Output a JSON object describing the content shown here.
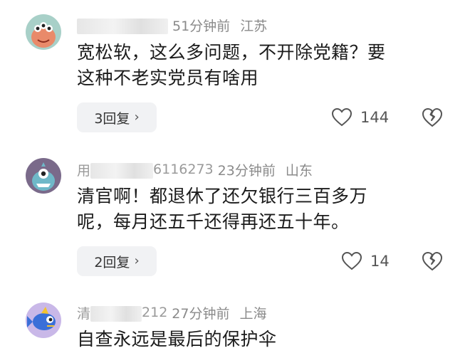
{
  "comments": [
    {
      "username_visible": "",
      "time": "51分钟前",
      "location": "江苏",
      "text_lines": [
        "宽松软，这么多问题，不开除党籍？要",
        "这种不老实党员有啥用"
      ],
      "reply_label": "3回复",
      "likes": "144",
      "avatar_icon": "monster-avatar-icon",
      "avatar_color": "#a8d0c8"
    },
    {
      "username_visible": "用",
      "username_tail": "6116273",
      "time": "23分钟前",
      "location": "山东",
      "text_lines": [
        "清官啊！都退休了还欠银行三百多万",
        "呢，每月还五千还得再还五十年。"
      ],
      "reply_label": "2回复",
      "likes": "14",
      "avatar_icon": "monster-avatar-icon",
      "avatar_color": "#7a6a8a"
    },
    {
      "username_visible": "清",
      "username_tail": "212",
      "time": "27分钟前",
      "location": "上海",
      "text_lines": [
        "自查永远是最后的保护伞"
      ],
      "avatar_icon": "fish-avatar-icon",
      "avatar_color": "#c9b8e8"
    }
  ],
  "colors": {
    "reply_bg": "#f1f2f4",
    "meta_text": "#8a8a8a",
    "body_text": "#1b1b1b"
  }
}
